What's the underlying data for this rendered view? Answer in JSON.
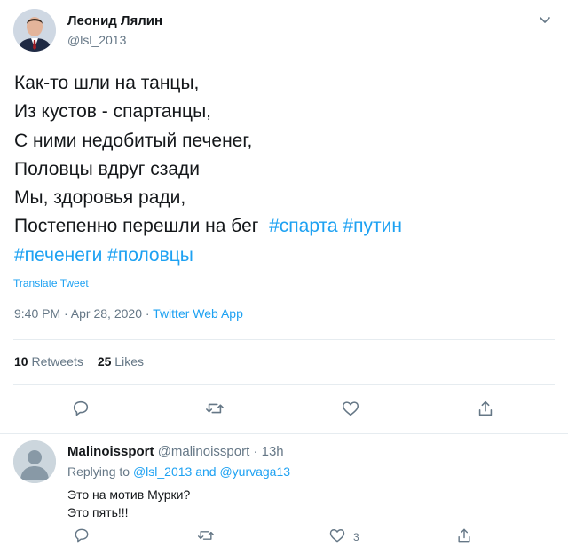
{
  "tweet": {
    "author_name": "Леонид Лялин",
    "author_handle": "@lsl_2013",
    "text_lines": [
      "Как-то шли на танцы,",
      "Из кустов - спартанцы,",
      "С ними недобитый печенег,",
      "Половцы вдруг сзади",
      "Мы, здоровья ради,"
    ],
    "last_line_text": "Постепенно перешли на бег",
    "hashtags": [
      "#спарта",
      "#путин",
      "#печенеги",
      "#половцы"
    ],
    "translate_label": "Translate Tweet",
    "timestamp": "9:40 PM · Apr 28, 2020 · ",
    "source": "Twitter Web App",
    "retweets_count": "10",
    "retweets_label": "Retweets",
    "likes_count": "25",
    "likes_label": "Likes",
    "icons": [
      "chevron-down-icon",
      "reply-icon",
      "retweet-icon",
      "like-icon",
      "share-icon"
    ]
  },
  "reply": {
    "name": "Malinoissport",
    "handle": "@malinoissport",
    "separator": " · ",
    "time": "13h",
    "replying_prefix": "Replying to ",
    "mention_1": "@lsl_2013",
    "and_word": " and ",
    "mention_2": "@yurvaga13",
    "text_lines": [
      "Это на мотив Мурки?",
      "Это пять!!!"
    ],
    "likes_count": "3"
  },
  "colors": {
    "accent": "#1da1f2",
    "text": "#14171a",
    "muted": "#657786",
    "border": "#e6ecf0"
  }
}
